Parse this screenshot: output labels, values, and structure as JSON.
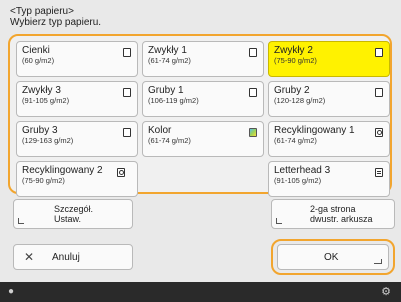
{
  "header": {
    "title": "<Typ papieru>",
    "instruction": "Wybierz typ papieru."
  },
  "paper_types": [
    {
      "label": "Cienki",
      "range": "(60 g/m2)",
      "icon": "paper-icon",
      "selected": false
    },
    {
      "label": "Zwykły 1",
      "range": "(61-74 g/m2)",
      "icon": "paper-icon",
      "selected": false
    },
    {
      "label": "Zwykły 2",
      "range": "(75-90 g/m2)",
      "icon": "paper-icon",
      "selected": true
    },
    {
      "label": "Zwykły 3",
      "range": "(91-105 g/m2)",
      "icon": "paper-icon",
      "selected": false
    },
    {
      "label": "Gruby 1",
      "range": "(106-119 g/m2)",
      "icon": "paper-icon",
      "selected": false
    },
    {
      "label": "Gruby 2",
      "range": "(120-128 g/m2)",
      "icon": "paper-icon",
      "selected": false
    },
    {
      "label": "Gruby 3",
      "range": "(129-163 g/m2)",
      "icon": "paper-icon",
      "selected": false
    },
    {
      "label": "Kolor",
      "range": "(61-74 g/m2)",
      "icon": "color-paper-icon",
      "selected": false
    },
    {
      "label": "Recyklingowany 1",
      "range": "(61-74 g/m2)",
      "icon": "recycled-paper-icon",
      "selected": false
    },
    {
      "label": "Recyklingowany 2",
      "range": "(75-90 g/m2)",
      "icon": "recycled-paper-icon",
      "selected": false
    },
    null,
    {
      "label": "Letterhead 3",
      "range": "(91-105 g/m2)",
      "icon": "letterhead-icon",
      "selected": false
    }
  ],
  "details_button": {
    "line1": "Szczegół.",
    "line2": "Ustaw."
  },
  "back_side_button": {
    "line1": "2-ga strona",
    "line2": "dwustr. arkusza"
  },
  "cancel_button": {
    "icon": "close-icon",
    "label": "Anuluj"
  },
  "ok_button": {
    "label": "OK"
  },
  "colors": {
    "accent": "#f2a52e",
    "selected": "#fff200",
    "status_bar": "#2a2a2a"
  }
}
